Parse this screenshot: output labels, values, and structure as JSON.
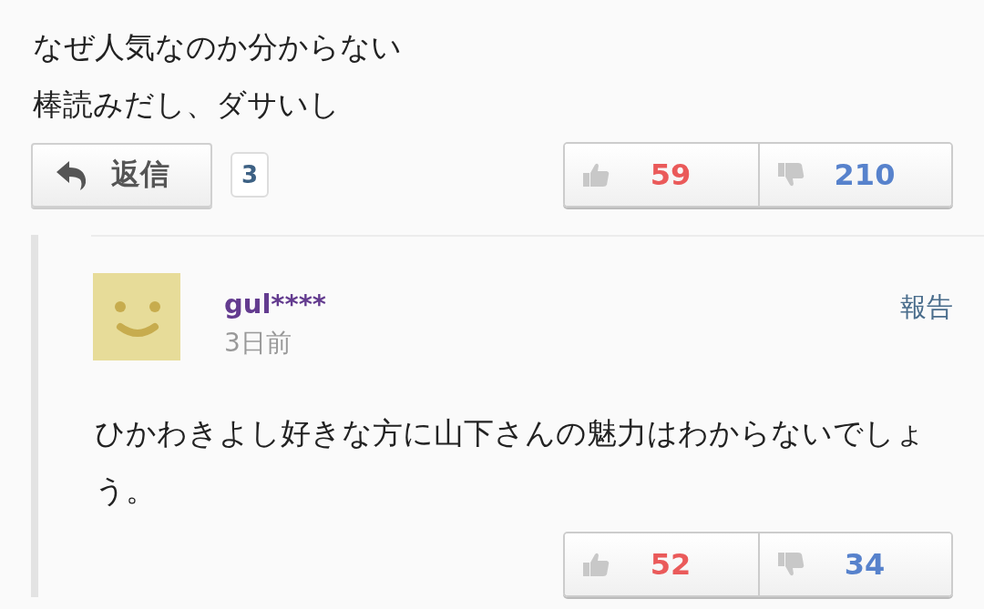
{
  "comment": {
    "text_lines": [
      "なぜ人気なのか分からない",
      "棒読みだし、ダサいし"
    ],
    "reply_button": {
      "label": "返信"
    },
    "reply_count": "3",
    "likes": "59",
    "dislikes": "210"
  },
  "replies": [
    {
      "username": "gul****",
      "time": "3日前",
      "report": "報告",
      "text": "ひかわきよし好きな方に山下さんの魅力はわからないでしょう。",
      "likes": "52",
      "dislikes": "34"
    }
  ]
}
